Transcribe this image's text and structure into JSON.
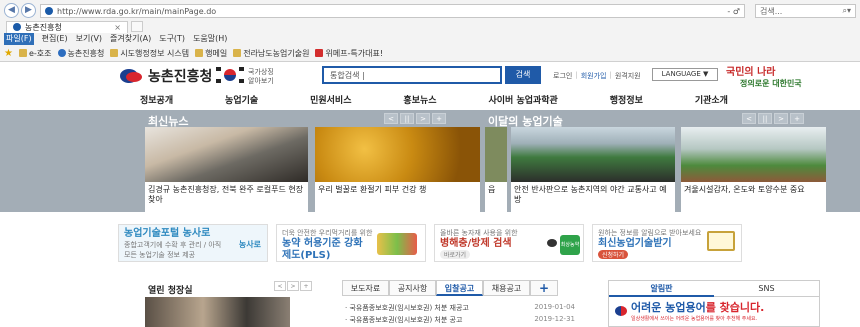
{
  "browser": {
    "url": "http://www.rda.go.kr/main/mainPage.do",
    "address_controls": "- ♂",
    "search_placeholder": "검색...",
    "search_icon": "search-icon",
    "tab_title": "농촌진흥청",
    "tab_close": "×",
    "menu": [
      "파일(F)",
      "편집(E)",
      "보기(V)",
      "즐겨찾기(A)",
      "도구(T)",
      "도움말(H)"
    ],
    "favorites": [
      "e-호조",
      "농촌진흥청",
      "시도행정정보 시스템",
      "행메일",
      "전라남도농업기술원",
      "위메프-특가대표!"
    ]
  },
  "header": {
    "logo_text": "농촌진흥청",
    "nation_link": [
      "국가상징",
      "알아보기"
    ],
    "search_value": "통합검색 |",
    "search_button": "검색",
    "util_links": [
      "로그인",
      "회원가입",
      "원격지원"
    ],
    "language": "LANGUAGE ▼",
    "slogan_line1": "국민의 나라",
    "slogan_line2": "정의로운 대한민국"
  },
  "gnb": [
    "정보공개",
    "농업기술",
    "민원서비스",
    "홍보뉴스",
    "사이버 농업과학관",
    "행정정보",
    "기관소개"
  ],
  "news": {
    "latest_title": "최신뉴스",
    "tech_title_pre": "이달의 ",
    "tech_title_bold": "농업기술",
    "pager": [
      "<",
      "||",
      ">",
      "+"
    ],
    "cards": [
      {
        "caption": "김경규 농촌진흥청장, 전북 완주 로컬푸드 현장 찾아"
      },
      {
        "caption": "우리 벌꿀로 환절기 피부 건강 챙"
      },
      {
        "caption": "읍"
      },
      {
        "caption": "안전 반사판으로 농촌지역의 야간 교통사고 예방"
      },
      {
        "caption": "겨울시설감자, 온도와 토양수분 중요"
      }
    ]
  },
  "banners": [
    {
      "t1": "",
      "t2": "농업기술포털 농사로",
      "t3": "종합고객기에 수확 후 관리 / 아직 모든 농업기술 정보 제공",
      "badge": "농사로"
    },
    {
      "t1": "더욱 안전한 우리먹거리를 위한",
      "t2": "농약 허용기준 강화제도(PLS)",
      "t3": "",
      "badge": ""
    },
    {
      "t1": "올바른 농자재 사용을 위한",
      "t2": "병해충/방제 검색",
      "t3": "바로가기",
      "badge": "최상농약"
    },
    {
      "t1": "원하는 정보를 알림으로 받아보세요",
      "t2": "최신농업기술받기",
      "t3": "",
      "badge": "신청하기"
    }
  ],
  "bottom": {
    "open_hall": "열린 청장실",
    "small_pager": [
      "<",
      ">",
      "+"
    ],
    "tabs": [
      "보도자료",
      "공지사항",
      "입찰공고",
      "채용공고",
      "+"
    ],
    "active_tab": "입찰공고",
    "notices": [
      {
        "title": "· 국유품종보호권(임시보호권) 처분 재공고",
        "date": "2019-01-04"
      },
      {
        "title": "· 국유품종보호권(임시보호권) 처분 공고",
        "date": "2019-12-31"
      }
    ],
    "right_tabs": [
      "알림판",
      "SNS"
    ],
    "right_banner_pre": "어려운 ",
    "right_banner_bold": "농업용어",
    "right_banner_post": "를 찾습니다.",
    "right_banner_sub": "일상생활에서 쓰이는 어려운 농업용어를 찾아 추천해 주세요."
  }
}
